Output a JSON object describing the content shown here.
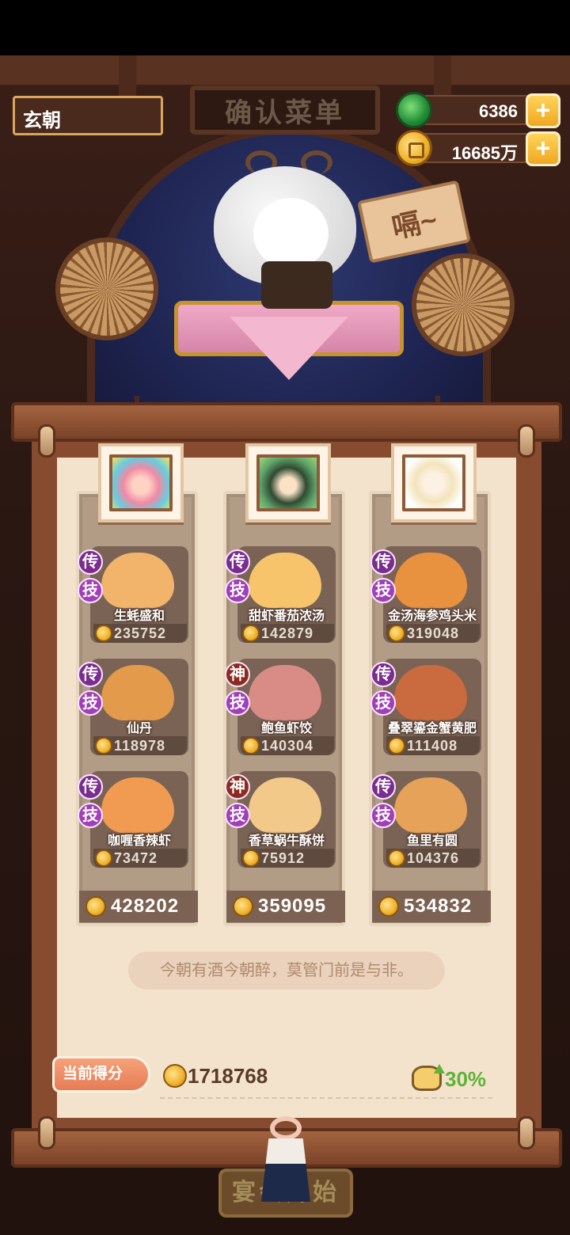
{
  "player": {
    "name": "玄朝"
  },
  "sign": {
    "title": "确认菜单"
  },
  "resources": {
    "jade": {
      "value": "6386",
      "icon": "jade-icon"
    },
    "coins": {
      "value": "16685万",
      "icon": "coin-icon"
    }
  },
  "speech": {
    "text": "嗝~"
  },
  "columns": [
    {
      "portrait": "chef-portrait-1",
      "dishes": [
        {
          "name": "生蚝盛和",
          "price": "235752",
          "rank": "传",
          "skill": "技",
          "color": "#f2b36b"
        },
        {
          "name": "仙丹",
          "price": "118978",
          "rank": "传",
          "skill": "技",
          "color": "#e39a4a"
        },
        {
          "name": "咖喱香辣虾",
          "price": "73472",
          "rank": "传",
          "skill": "技",
          "color": "#f19b52"
        }
      ],
      "total": "428202"
    },
    {
      "portrait": "chef-portrait-2",
      "dishes": [
        {
          "name": "甜虾番茄浓汤",
          "price": "142879",
          "rank": "传",
          "skill": "技",
          "color": "#f7c46b"
        },
        {
          "name": "鲍鱼虾饺",
          "price": "140304",
          "rank": "神",
          "skill": "技",
          "color": "#d98c85"
        },
        {
          "name": "香草蜗牛酥饼",
          "price": "75912",
          "rank": "神",
          "skill": "技",
          "color": "#f3c98a"
        }
      ],
      "total": "359095"
    },
    {
      "portrait": "chef-portrait-3",
      "dishes": [
        {
          "name": "金汤海参鸡头米",
          "price": "319048",
          "rank": "传",
          "skill": "技",
          "color": "#e8913e"
        },
        {
          "name": "叠翠鎏金蟹黄肥",
          "price": "111408",
          "rank": "传",
          "skill": "技",
          "color": "#c96a3f"
        },
        {
          "name": "鱼里有圆",
          "price": "104376",
          "rank": "传",
          "skill": "技",
          "color": "#e7a25a"
        }
      ],
      "total": "534832"
    }
  ],
  "quote": "今朝有酒今朝醉，莫管门前是与非。",
  "score": {
    "label": "当前得分",
    "value": "1718768",
    "bonus": "30%"
  },
  "start_button": "宴会开始"
}
